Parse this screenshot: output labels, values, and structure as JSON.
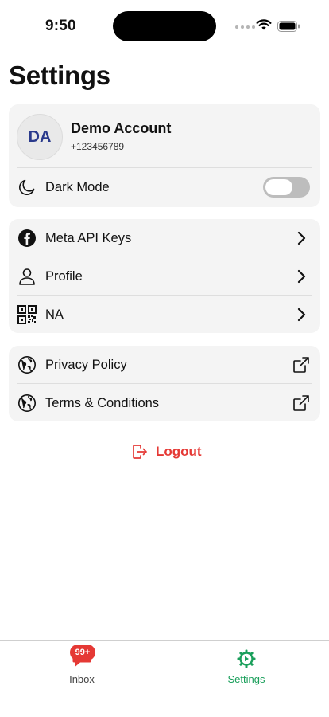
{
  "status_bar": {
    "time": "9:50"
  },
  "page": {
    "title": "Settings"
  },
  "account": {
    "initials": "DA",
    "name": "Demo Account",
    "phone": "+123456789"
  },
  "dark_mode": {
    "label": "Dark Mode",
    "enabled": false
  },
  "links": [
    {
      "label": "Meta API Keys",
      "icon": "facebook-icon"
    },
    {
      "label": "Profile",
      "icon": "person-icon"
    },
    {
      "label": "NA",
      "icon": "qr-code-icon"
    }
  ],
  "legal": [
    {
      "label": "Privacy Policy",
      "icon": "globe-icon"
    },
    {
      "label": "Terms & Conditions",
      "icon": "globe-icon"
    }
  ],
  "logout": {
    "label": "Logout"
  },
  "tabs": [
    {
      "label": "Inbox",
      "badge": "99+",
      "active": false
    },
    {
      "label": "Settings",
      "active": true
    }
  ],
  "colors": {
    "accent_green": "#1a9f5b",
    "danger_red": "#e53935",
    "avatar_text": "#2a3a8c",
    "card_bg": "#f4f4f4"
  }
}
